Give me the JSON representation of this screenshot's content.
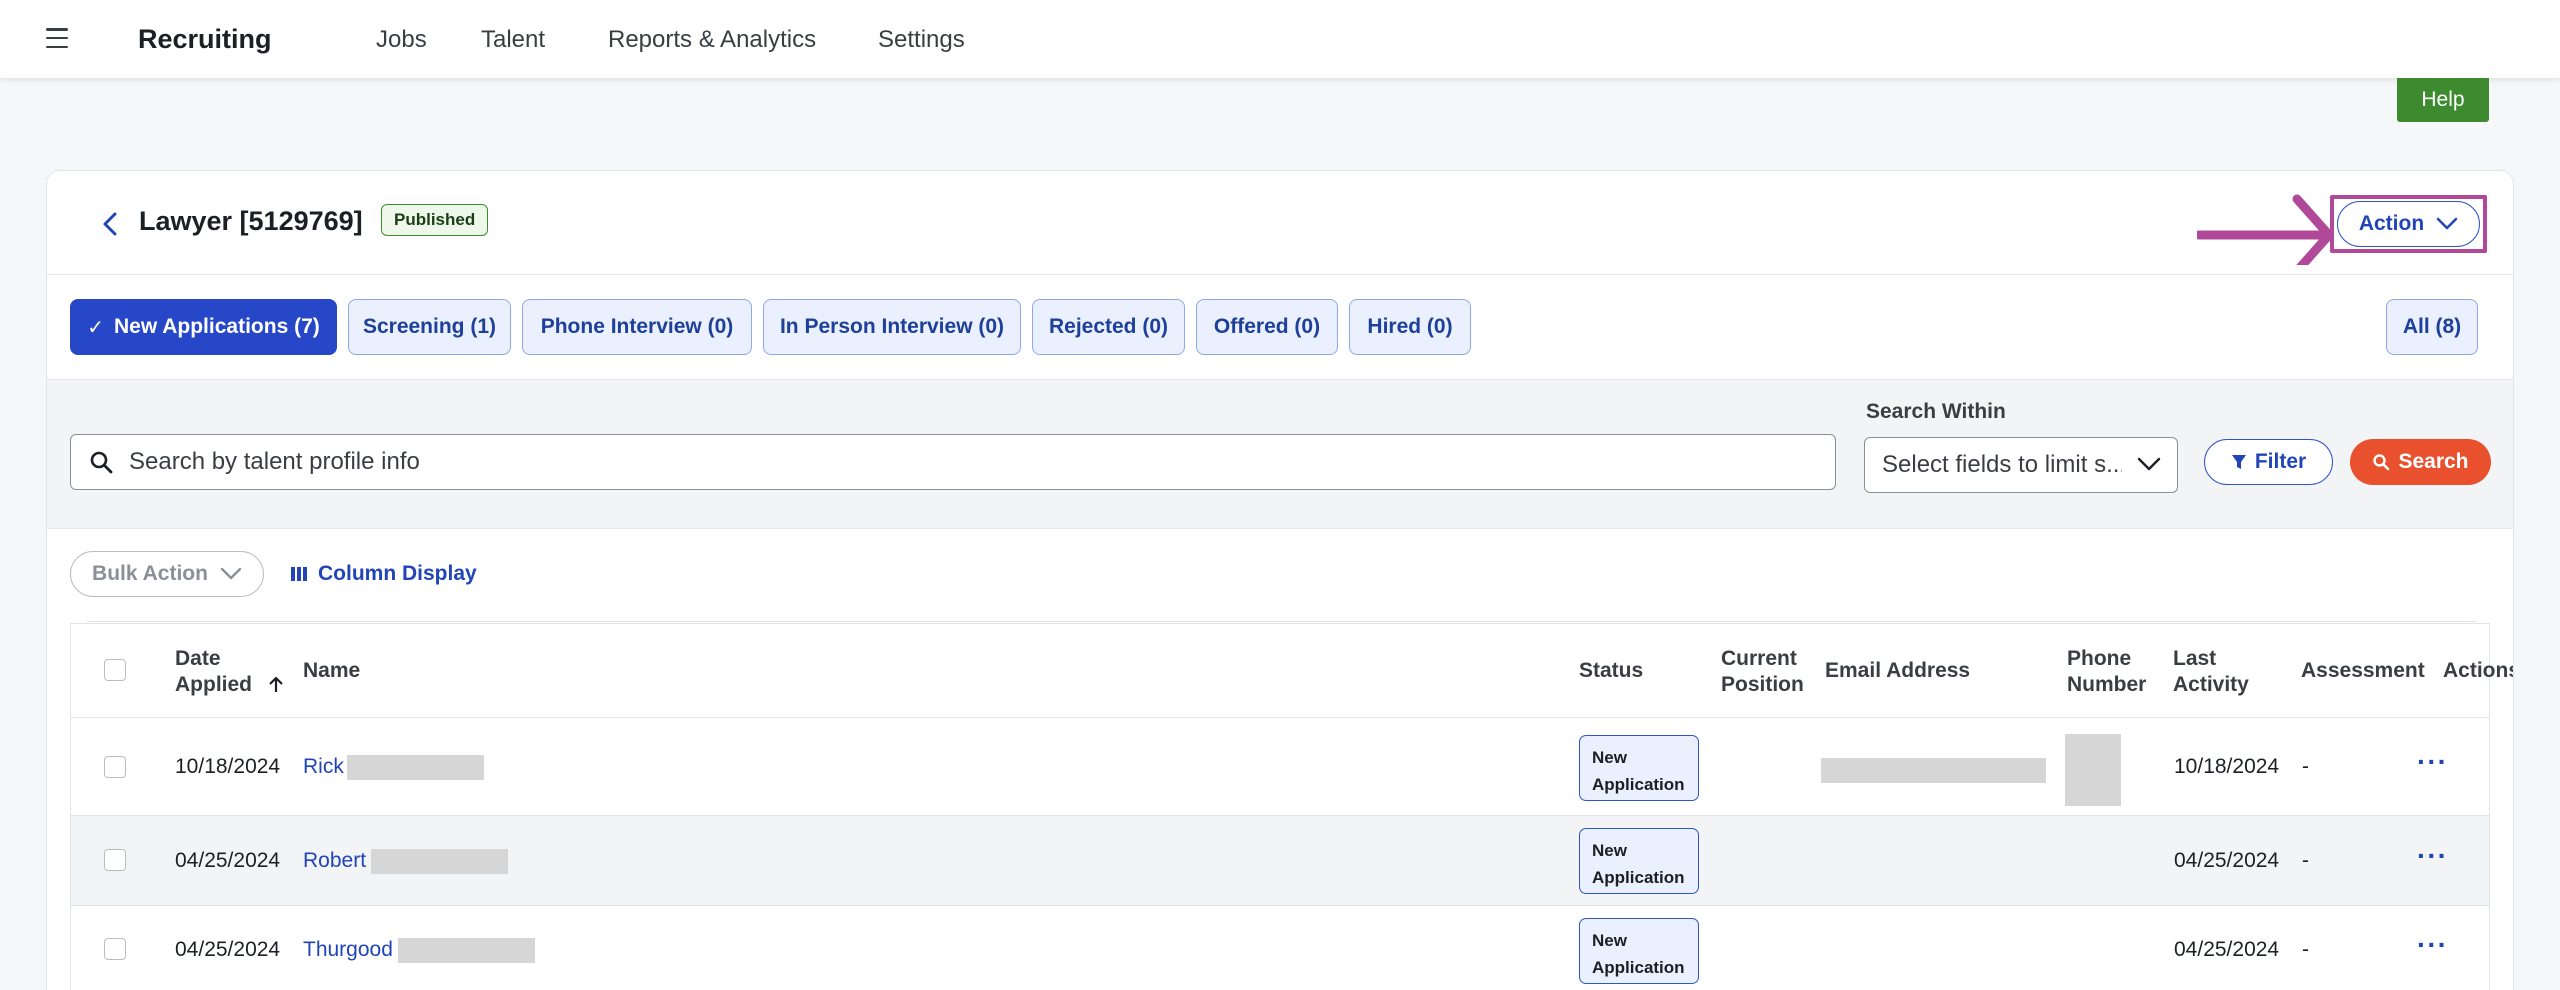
{
  "topnav": {
    "brand": "Recruiting",
    "items": [
      "Jobs",
      "Talent",
      "Reports & Analytics",
      "Settings"
    ]
  },
  "help_label": "Help",
  "job": {
    "title": "Lawyer [5129769]",
    "status": "Published",
    "action_label": "Action"
  },
  "tabs": [
    {
      "label": "New Applications (7)",
      "active": true
    },
    {
      "label": "Screening (1)"
    },
    {
      "label": "Phone Interview (0)"
    },
    {
      "label": "In Person Interview (0)"
    },
    {
      "label": "Rejected (0)"
    },
    {
      "label": "Offered (0)"
    },
    {
      "label": "Hired (0)"
    },
    {
      "label": "All (8)"
    }
  ],
  "search": {
    "placeholder": "Search by talent profile info",
    "within_label": "Search Within",
    "within_placeholder": "Select fields to limit s...",
    "filter_label": "Filter",
    "search_label": "Search"
  },
  "toolbar": {
    "bulk_action": "Bulk Action",
    "column_display": "Column Display"
  },
  "table": {
    "headers": {
      "date_applied_1": "Date",
      "date_applied_2": "Applied",
      "name": "Name",
      "status": "Status",
      "current_position_1": "Current",
      "current_position_2": "Position",
      "email": "Email Address",
      "phone_1": "Phone",
      "phone_2": "Number",
      "last_activity_1": "Last",
      "last_activity_2": "Activity",
      "assessment": "Assessment",
      "actions": "Actions"
    },
    "rows": [
      {
        "date": "10/18/2024",
        "first_name": "Rick",
        "status_1": "New",
        "status_2": "Application",
        "last_activity": "10/18/2024",
        "assessment": "-",
        "actions": "···"
      },
      {
        "date": "04/25/2024",
        "first_name": "Robert",
        "status_1": "New",
        "status_2": "Application",
        "last_activity": "04/25/2024",
        "assessment": "-",
        "actions": "···"
      },
      {
        "date": "04/25/2024",
        "first_name": "Thurgood",
        "status_1": "New",
        "status_2": "Application",
        "last_activity": "04/25/2024",
        "assessment": "-",
        "actions": "···"
      }
    ]
  },
  "colors": {
    "primary": "#2747c9",
    "help_green": "#3d8b2e",
    "search_orange": "#e8502e",
    "annotation_magenta": "#b0499a"
  }
}
